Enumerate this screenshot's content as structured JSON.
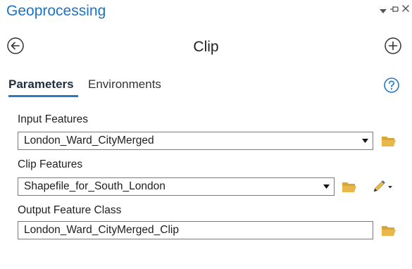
{
  "pane": {
    "title": "Geoprocessing"
  },
  "tool": {
    "title": "Clip"
  },
  "tabs": [
    {
      "label": "Parameters",
      "active": true
    },
    {
      "label": "Environments",
      "active": false
    }
  ],
  "parameters": {
    "input_features": {
      "label": "Input Features",
      "value": "London_Ward_CityMerged"
    },
    "clip_features": {
      "label": "Clip Features",
      "value": "Shapefile_for_South_London"
    },
    "output_feature_class": {
      "label": "Output Feature Class",
      "value": "London_Ward_CityMerged_Clip"
    }
  },
  "icons": {
    "pane_menu": "chevron-down-icon",
    "pane_pin": "pin-icon",
    "pane_close": "close-icon",
    "back": "back-circle-icon",
    "add": "add-circle-icon",
    "help": "help-icon",
    "browse": "folder-icon",
    "sketch": "pencil-icon"
  },
  "colors": {
    "accent": "#2b79c2",
    "title": "#1a73c8",
    "folder": "#e8b84a"
  }
}
